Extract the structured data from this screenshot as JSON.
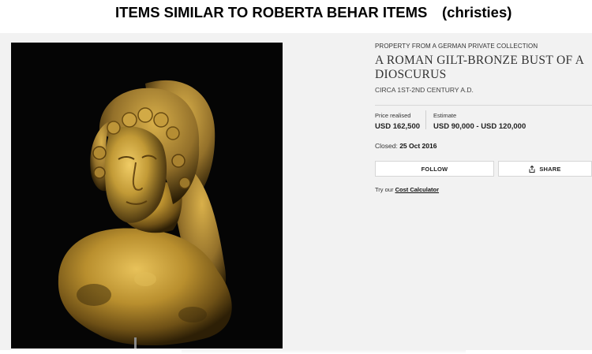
{
  "heading": {
    "main": "ITEMS SIMILAR TO ROBERTA BEHAR ITEMS",
    "source": "(christies)"
  },
  "lot": {
    "provenance": "PROPERTY FROM A GERMAN PRIVATE COLLECTION",
    "title": "A ROMAN GILT-BRONZE BUST OF A DIOSCURUS",
    "date": "CIRCA 1ST-2ND CENTURY A.D.",
    "price_realised": {
      "label": "Price realised",
      "value": "USD 162,500"
    },
    "estimate": {
      "label": "Estimate",
      "value": "USD 90,000 - USD 120,000"
    },
    "closed": {
      "label": "Closed:",
      "value": "25 Oct 2016"
    },
    "follow_label": "FOLLOW",
    "share_label": "SHARE",
    "calculator": {
      "prefix": "Try our",
      "link": "Cost Calculator"
    }
  },
  "icons": {
    "share": "share-icon"
  },
  "colors": {
    "panel_background": "#f2f2f2",
    "photo_background": "#050505",
    "bronze_gold": "#b8902c"
  }
}
